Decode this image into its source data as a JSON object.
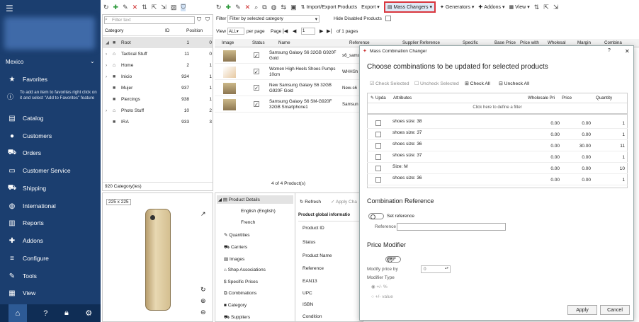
{
  "nav": {
    "store": "Mexico",
    "items": [
      "Favorites",
      "Catalog",
      "Customers",
      "Orders",
      "Customer Service",
      "Shipping",
      "International",
      "Reports",
      "Addons",
      "Configure",
      "Tools",
      "View"
    ],
    "fav_hint": "To add an item to favorites right click on it and select \"Add to Favorites\" feature"
  },
  "toolbar": {
    "import_export": "Import/Export Products",
    "export": "Export",
    "mass_changers": "Mass Changers",
    "generators": "Generators",
    "addons": "Addons",
    "view": "View"
  },
  "categories": {
    "filter_placeholder": "Filter text",
    "col_category": "Category",
    "col_id": "ID",
    "col_position": "Position",
    "rows": [
      {
        "name": "Root",
        "id": "1",
        "pos": "0"
      },
      {
        "name": "Tactical Stuff",
        "id": "11",
        "pos": "0"
      },
      {
        "name": "Home",
        "id": "2",
        "pos": "1"
      },
      {
        "name": "Inicio",
        "id": "934",
        "pos": "1"
      },
      {
        "name": "Mujer",
        "id": "937",
        "pos": "1"
      },
      {
        "name": "Piercings",
        "id": "938",
        "pos": "1"
      },
      {
        "name": "Photo Stuff",
        "id": "10",
        "pos": "2"
      },
      {
        "name": "IRA",
        "id": "933",
        "pos": "3"
      }
    ],
    "footer": "920 Category(ies)"
  },
  "image_panel": {
    "size_label": "225 x 225"
  },
  "grid": {
    "filter_label": "Filter",
    "filter_value": "Filter by selected category",
    "hide_disabled": "Hide Disabled Products",
    "view_label": "View",
    "view_value": "ALL",
    "per_page": "per page",
    "page_label": "Page",
    "page_value": "1",
    "of_pages": "of 1 pages",
    "headers": [
      "Image",
      "Status",
      "Name",
      "Reference",
      "Supplier Reference",
      "Specific",
      "Base Price",
      "Price with",
      "Wholesal",
      "Margin",
      "Combina"
    ],
    "rows": [
      {
        "name": "Samsung Galaxy S6 32GB G920F Gold",
        "ref": "s6_sams"
      },
      {
        "name": "Women High Heels Shoes Pumps 10cm",
        "ref": "WHHSh"
      },
      {
        "name": "New Samsung Galaxy S6 32GB G920F Gold",
        "ref": "New-s6"
      },
      {
        "name": "Samsung Galaxy S6 SM-G920F 32GB Smartphone1",
        "ref": "Samsun"
      }
    ],
    "footer": "4 of 4 Product(s)"
  },
  "details": {
    "tree": [
      "Product Details",
      "English (English)",
      "French",
      "Quantities",
      "Carriers",
      "Images",
      "Shop Associations",
      "Specific Prices",
      "Combinations",
      "Category",
      "Suppliers"
    ],
    "refresh": "Refresh",
    "apply": "Apply Cha",
    "section": "Product global informatio",
    "fields": [
      "Product ID",
      "Status",
      "Product Name",
      "Reference",
      "EAN13",
      "UPC",
      "ISBN",
      "Condition"
    ]
  },
  "dialog": {
    "title": "Mass Combination Changer",
    "heading": "Choose combinations to be updated for selected products",
    "check_selected": "Check Selected",
    "uncheck_selected": "Uncheck Selected",
    "check_all": "Check All",
    "uncheck_all": "Uncheck All",
    "col_update": "Upda",
    "col_attributes": "Attributes",
    "col_wholesale": "Wholesale Pri",
    "col_price": "Price",
    "col_quantity": "Quantity",
    "filter_hint": "Click here to define a filter",
    "rows": [
      {
        "attr": "shoes size: 38",
        "wholesale": "0.00",
        "price": "0.00",
        "qty": "1"
      },
      {
        "attr": "shoes size: 37",
        "wholesale": "0.00",
        "price": "0.00",
        "qty": "1"
      },
      {
        "attr": "shoes size: 36",
        "wholesale": "0.00",
        "price": "30.00",
        "qty": "11"
      },
      {
        "attr": "shoes size: 37",
        "wholesale": "0.00",
        "price": "0.00",
        "qty": "1"
      },
      {
        "attr": "Size: M",
        "wholesale": "0.00",
        "price": "0.00",
        "qty": "10"
      },
      {
        "attr": "shoes size: 36",
        "wholesale": "0.00",
        "price": "0.00",
        "qty": "1"
      }
    ],
    "comb_ref_heading": "Combination Reference",
    "set_reference": "Set reference",
    "reference_label": "Reference",
    "price_mod_heading": "Price Modifier",
    "off": "OFF",
    "modify_by_label": "Modify price by",
    "modify_by_value": "0",
    "modifier_type": "Modifier Type",
    "opt_percent": "+/- %",
    "opt_value": "+/- value",
    "apply": "Apply",
    "cancel": "Cancel"
  }
}
